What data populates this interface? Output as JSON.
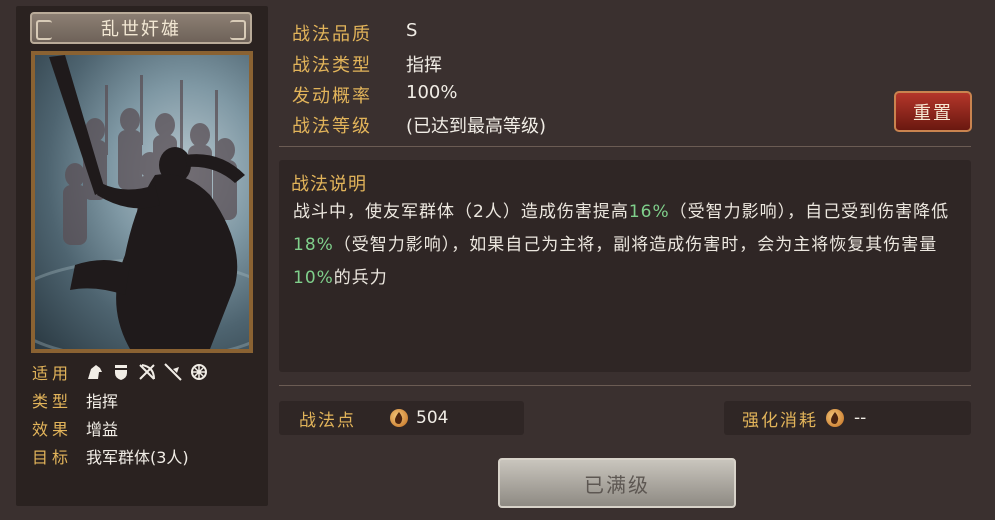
{
  "skill": {
    "name": "乱世奸雄"
  },
  "info": {
    "applicable_label": "适用",
    "type_label": "类型",
    "type_value": "指挥",
    "effect_label": "效果",
    "effect_value": "增益",
    "target_label": "目标",
    "target_value": "我军群体(3人)",
    "troop_icons": [
      "cavalry-icon",
      "shield-icon",
      "bow-icon",
      "spear-icon",
      "wheel-icon"
    ]
  },
  "attributes": {
    "quality_label": "战法品质",
    "quality_value": "S",
    "category_label": "战法类型",
    "category_value": "指挥",
    "trigger_label": "发动概率",
    "trigger_value": "100%",
    "level_label": "战法等级",
    "level_value": "(已达到最高等级)"
  },
  "reset_button_label": "重置",
  "description": {
    "title": "战法说明",
    "parts": {
      "p1": "战斗中，使友军群体（2人）造成伤害提高",
      "h1": "16%",
      "p2": "（受智力影响），自己受到伤害降低",
      "h2": "18%",
      "p3": "（受智力影响），如果自己为主将，副将造成伤害时，会为主将恢复其伤害量",
      "h3": "10%",
      "p4": "的兵力"
    }
  },
  "tactic_points": {
    "label": "战法点",
    "value": "504"
  },
  "upgrade_cost": {
    "label": "强化消耗",
    "value": "--"
  },
  "maxed_button_label": "已满级",
  "colors": {
    "label_gold": "#e2b45a",
    "highlight_green": "#7fcf8b",
    "reset_red": "#b4362a"
  }
}
